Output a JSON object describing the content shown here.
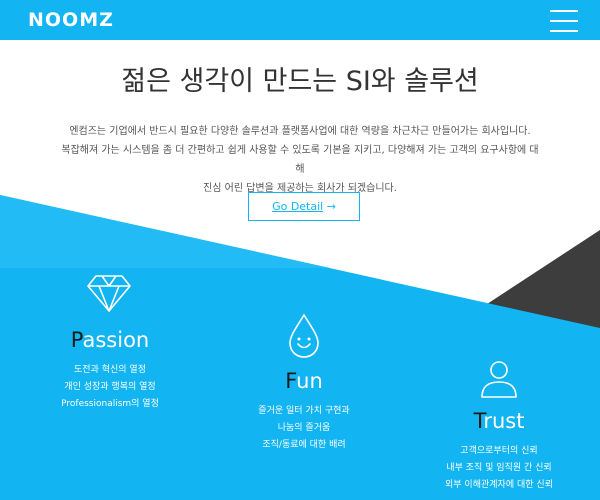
{
  "header": {
    "logo": "NOOMZ",
    "menu_icon": "hamburger-menu-icon"
  },
  "hero": {
    "title": "젊은 생각이 만드는 SI와 솔루션",
    "description": "엔컴즈는 기업에서 반드시 필요한 다양한 솔루션과 플랫폼사업에 대한 역량을 차근차근 만들어가는 회사입니다.\n복잡해져 가는 시스템을 좀 더 간편하고 쉽게 사용할 수 있도록 기본을 지키고, 다양해져 가는 고객의 요구사항에 대해\n진심 어린 답변을 제공하는 회사가 되겠습니다.",
    "button_label": "Go Detail",
    "button_icon": "arrow-right-icon"
  },
  "colors": {
    "brand_blue": "#12b4f2",
    "dark_gray": "#3a3a3a",
    "light_blue": "#22bbf5"
  },
  "values": [
    {
      "first": "P",
      "rest": "assion",
      "icon": "diamond-icon",
      "items": [
        "도전과 혁신의 열정",
        "개인 성장과 행복의 열정",
        "Professionalism의 열정"
      ]
    },
    {
      "first": "F",
      "rest": "un",
      "icon": "smiling-drop-icon",
      "items": [
        "즐거운 일터 가치 구현과",
        "나눔의 즐거움",
        "조직/동료에 대한 배려"
      ]
    },
    {
      "first": "T",
      "rest": "rust",
      "icon": "person-icon",
      "items": [
        "고객으로부터의 신뢰",
        "내부 조직 및 임직원 간 신뢰",
        "외부 이해관계자에 대한 신뢰"
      ]
    }
  ]
}
